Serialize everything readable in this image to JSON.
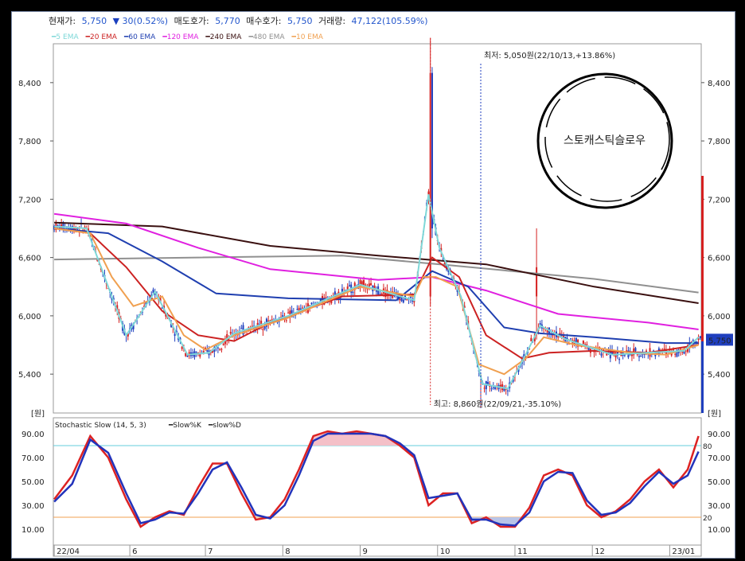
{
  "quote": {
    "price_label": "현재가:",
    "price": "5,750",
    "change_arrow": "▼",
    "change": "30(0.52%)",
    "ask_label": "매도호가:",
    "ask": "5,770",
    "bid_label": "매수호가:",
    "bid": "5,750",
    "volume_label": "거래량:",
    "volume": "47,122(105.59%)"
  },
  "legend": [
    {
      "label": "5 EMA",
      "color": "#7fd8d8"
    },
    {
      "label": "20 EMA",
      "color": "#cc2222"
    },
    {
      "label": "60 EMA",
      "color": "#1f3fb0"
    },
    {
      "label": "120 EMA",
      "color": "#e020e0"
    },
    {
      "label": "240 EMA",
      "color": "#3a1010"
    },
    {
      "label": "480 EMA",
      "color": "#909090"
    },
    {
      "label": "10 EMA",
      "color": "#f0a050"
    }
  ],
  "annotations": {
    "low_note": "최저: 5,050원(22/10/13,+13.86%)",
    "high_note": "최고: 8,860원(22/09/21,-35.10%)",
    "stamp_text": "스토캐스틱슬로우",
    "current_price_tag": "5,750",
    "unit_left": "[원]",
    "unit_right": "[원]"
  },
  "chart_data": {
    "type": "candlestick",
    "price_axis": {
      "ticks": [
        "8,400",
        "7,800",
        "7,200",
        "6,600",
        "6,000",
        "5,400"
      ],
      "values": [
        8400,
        7800,
        7200,
        6600,
        6000,
        5400
      ],
      "range": [
        5000,
        8800
      ]
    },
    "x_labels": [
      "22/04",
      "6",
      "7",
      "8",
      "9",
      "10",
      "11",
      "12",
      "23/01"
    ],
    "x_label_positions": [
      0,
      42,
      84,
      127,
      170,
      213,
      256,
      299,
      342
    ],
    "total_bars": 360,
    "events": {
      "high": {
        "bar": 209,
        "price": 8860
      },
      "low": {
        "bar": 237,
        "price": 5050
      }
    },
    "current_price": 5750,
    "stochastic": {
      "title": "Stochastic Slow (14, 5, 3)",
      "series_names": [
        "Slow%K",
        "slow%D"
      ],
      "colors": [
        "#dd2222",
        "#2233bb"
      ],
      "axis_ticks": [
        "90.00",
        "70.00",
        "50.00",
        "30.00",
        "10.00"
      ],
      "axis_values": [
        90,
        70,
        50,
        30,
        10
      ],
      "upper_line": 80,
      "lower_line": 20,
      "upper_label": "80",
      "lower_label": "20",
      "k_points": [
        [
          0,
          35
        ],
        [
          10,
          55
        ],
        [
          20,
          88
        ],
        [
          30,
          70
        ],
        [
          40,
          35
        ],
        [
          48,
          12
        ],
        [
          56,
          20
        ],
        [
          64,
          25
        ],
        [
          72,
          22
        ],
        [
          80,
          45
        ],
        [
          88,
          65
        ],
        [
          96,
          65
        ],
        [
          104,
          40
        ],
        [
          112,
          18
        ],
        [
          120,
          20
        ],
        [
          128,
          35
        ],
        [
          136,
          60
        ],
        [
          144,
          88
        ],
        [
          152,
          92
        ],
        [
          160,
          90
        ],
        [
          168,
          92
        ],
        [
          176,
          90
        ],
        [
          184,
          88
        ],
        [
          192,
          80
        ],
        [
          200,
          70
        ],
        [
          208,
          30
        ],
        [
          216,
          40
        ],
        [
          224,
          40
        ],
        [
          232,
          15
        ],
        [
          240,
          20
        ],
        [
          248,
          12
        ],
        [
          256,
          12
        ],
        [
          264,
          28
        ],
        [
          272,
          55
        ],
        [
          280,
          60
        ],
        [
          288,
          55
        ],
        [
          296,
          30
        ],
        [
          304,
          20
        ],
        [
          312,
          25
        ],
        [
          320,
          35
        ],
        [
          328,
          50
        ],
        [
          336,
          60
        ],
        [
          344,
          45
        ],
        [
          352,
          60
        ],
        [
          358,
          88
        ]
      ],
      "d_points": [
        [
          0,
          33
        ],
        [
          10,
          48
        ],
        [
          20,
          85
        ],
        [
          30,
          74
        ],
        [
          40,
          40
        ],
        [
          48,
          15
        ],
        [
          56,
          18
        ],
        [
          64,
          24
        ],
        [
          72,
          23
        ],
        [
          80,
          40
        ],
        [
          88,
          60
        ],
        [
          96,
          66
        ],
        [
          104,
          45
        ],
        [
          112,
          22
        ],
        [
          120,
          19
        ],
        [
          128,
          30
        ],
        [
          136,
          55
        ],
        [
          144,
          84
        ],
        [
          152,
          90
        ],
        [
          160,
          90
        ],
        [
          168,
          90
        ],
        [
          176,
          90
        ],
        [
          184,
          88
        ],
        [
          192,
          82
        ],
        [
          200,
          72
        ],
        [
          208,
          36
        ],
        [
          216,
          38
        ],
        [
          224,
          40
        ],
        [
          232,
          18
        ],
        [
          240,
          18
        ],
        [
          248,
          14
        ],
        [
          256,
          13
        ],
        [
          264,
          24
        ],
        [
          272,
          50
        ],
        [
          280,
          58
        ],
        [
          288,
          57
        ],
        [
          296,
          34
        ],
        [
          304,
          22
        ],
        [
          312,
          24
        ],
        [
          320,
          32
        ],
        [
          328,
          46
        ],
        [
          336,
          58
        ],
        [
          344,
          48
        ],
        [
          352,
          55
        ],
        [
          358,
          75
        ]
      ]
    },
    "ema": {
      "ema240": [
        [
          0,
          6960
        ],
        [
          60,
          6920
        ],
        [
          120,
          6720
        ],
        [
          180,
          6620
        ],
        [
          240,
          6530
        ],
        [
          300,
          6300
        ],
        [
          358,
          6130
        ]
      ],
      "ema480": [
        [
          0,
          6580
        ],
        [
          80,
          6600
        ],
        [
          160,
          6620
        ],
        [
          220,
          6520
        ],
        [
          300,
          6380
        ],
        [
          358,
          6240
        ]
      ],
      "ema120": [
        [
          0,
          7050
        ],
        [
          40,
          6950
        ],
        [
          80,
          6700
        ],
        [
          120,
          6480
        ],
        [
          180,
          6370
        ],
        [
          210,
          6400
        ],
        [
          240,
          6260
        ],
        [
          280,
          6020
        ],
        [
          330,
          5930
        ],
        [
          358,
          5860
        ]
      ],
      "ema60": [
        [
          0,
          6900
        ],
        [
          30,
          6850
        ],
        [
          60,
          6560
        ],
        [
          90,
          6230
        ],
        [
          130,
          6180
        ],
        [
          190,
          6160
        ],
        [
          210,
          6460
        ],
        [
          230,
          6300
        ],
        [
          250,
          5880
        ],
        [
          270,
          5820
        ],
        [
          300,
          5780
        ],
        [
          340,
          5720
        ],
        [
          358,
          5720
        ]
      ],
      "ema20": [
        [
          0,
          6900
        ],
        [
          20,
          6850
        ],
        [
          40,
          6500
        ],
        [
          60,
          6050
        ],
        [
          80,
          5800
        ],
        [
          100,
          5740
        ],
        [
          120,
          5930
        ],
        [
          160,
          6200
        ],
        [
          200,
          6220
        ],
        [
          210,
          6600
        ],
        [
          225,
          6400
        ],
        [
          240,
          5800
        ],
        [
          260,
          5560
        ],
        [
          275,
          5620
        ],
        [
          300,
          5640
        ],
        [
          330,
          5620
        ],
        [
          358,
          5700
        ]
      ],
      "ema10": [
        [
          0,
          6900
        ],
        [
          20,
          6850
        ],
        [
          32,
          6400
        ],
        [
          44,
          6100
        ],
        [
          60,
          6200
        ],
        [
          72,
          5800
        ],
        [
          84,
          5650
        ],
        [
          100,
          5800
        ],
        [
          130,
          5980
        ],
        [
          170,
          6300
        ],
        [
          200,
          6200
        ],
        [
          205,
          6400
        ],
        [
          212,
          6400
        ],
        [
          224,
          6300
        ],
        [
          236,
          5500
        ],
        [
          250,
          5400
        ],
        [
          262,
          5560
        ],
        [
          272,
          5780
        ],
        [
          290,
          5700
        ],
        [
          320,
          5620
        ],
        [
          340,
          5600
        ],
        [
          358,
          5700
        ]
      ],
      "ema5": [
        [
          0,
          6920
        ],
        [
          18,
          6900
        ],
        [
          30,
          6300
        ],
        [
          40,
          5800
        ],
        [
          56,
          6250
        ],
        [
          74,
          5600
        ],
        [
          86,
          5620
        ],
        [
          100,
          5820
        ],
        [
          130,
          6000
        ],
        [
          170,
          6320
        ],
        [
          200,
          6160
        ],
        [
          208,
          7250
        ],
        [
          214,
          6700
        ],
        [
          226,
          6200
        ],
        [
          238,
          5300
        ],
        [
          252,
          5250
        ],
        [
          262,
          5600
        ],
        [
          270,
          5900
        ],
        [
          284,
          5760
        ],
        [
          310,
          5600
        ],
        [
          330,
          5620
        ],
        [
          350,
          5640
        ],
        [
          358,
          5780
        ]
      ]
    }
  }
}
